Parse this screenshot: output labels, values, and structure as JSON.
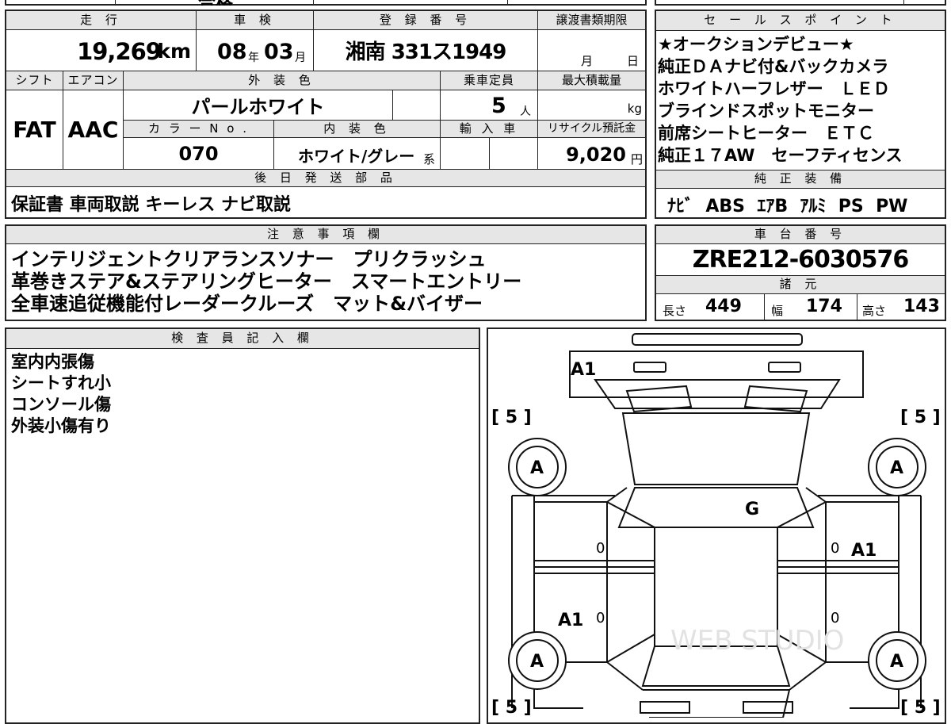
{
  "top_strip": {
    "text": "合格"
  },
  "main": {
    "labels": {
      "mileage": "走 行",
      "inspection": "車 検",
      "registration": "登 録 番 号",
      "transfer_deadline": "譲渡書類期限",
      "shift": "シフト",
      "ac": "エアコン",
      "exterior_color": "外 装 色",
      "capacity": "乗車定員",
      "max_load": "最大積載量",
      "color_no": "カ ラ ー N o .",
      "interior_color": "内 装 色",
      "import": "輸 入 車",
      "recycle_fee": "リサイクル預託金",
      "later_parts": "後 日 発 送 部 品"
    },
    "mileage": "19,269",
    "mileage_unit": "km",
    "inspection_year": "08",
    "year_suffix": "年",
    "inspection_month": "03",
    "month_suffix": "月",
    "plate": "湘南 331ス1949",
    "deadline_month_suffix": "月",
    "deadline_day_suffix": "日",
    "shift": "FAT",
    "ac": "AAC",
    "exterior_color": "パールホワイト",
    "capacity": "5",
    "capacity_unit": "人",
    "max_load_unit": "kg",
    "color_no": "070",
    "interior_color": "ホワイト/グレー",
    "interior_suffix": "系",
    "recycle_fee": "9,020",
    "recycle_unit": "円",
    "later_parts": "保証書 車両取説 キーレス ナビ取説"
  },
  "sales_points": {
    "label": "セ ー ル ス ポ イ ン ト",
    "lines": [
      "★オークションデビュー★",
      "純正ＤＡナビ付&バックカメラ",
      "ホワイトハーフレザー　ＬＥＤ",
      "ブラインドスポットモニター",
      "前席シートヒーター　ＥＴＣ",
      "純正１７AW　セーフティセンス"
    ]
  },
  "standard_equipment": {
    "label": "純 正 装 備",
    "items": [
      "ﾅﾋﾞ",
      "ABS",
      "ｴｱB",
      "ｱﾙﾐ",
      "PS",
      "PW"
    ]
  },
  "notes": {
    "label": "注 意 事 項 欄",
    "lines": [
      "インテリジェントクリアランスソナー　プリクラッシュ",
      "革巻きステア&ステアリングヒーター　スマートエントリー",
      "全車速追従機能付レーダークルーズ　マット&バイザー"
    ]
  },
  "chassis": {
    "label": "車 台 番 号",
    "number": "ZRE212-6030576",
    "spec_label": "諸 元",
    "length_label": "長さ",
    "length": "449",
    "width_label": "幅",
    "width": "174",
    "height_label": "高さ",
    "height": "143"
  },
  "inspector": {
    "label": "検 査 員 記 入 欄",
    "lines": [
      "室内内張傷",
      "シートすれ小",
      "コンソール傷",
      "外装小傷有り"
    ]
  },
  "diagram": {
    "tire_tl": "[ 5 ]",
    "tire_tr": "[ 5 ]",
    "tire_bl": "[ 5 ]",
    "tire_br": "[ 5 ]",
    "mark_front_bumper": "A1",
    "mark_wheel_fl": "A",
    "mark_wheel_fr": "A",
    "mark_wheel_rl": "A",
    "mark_wheel_rr": "A",
    "mark_windshield": "G",
    "mark_right_front_door": "A1",
    "mark_left_rear_door": "A1",
    "zero_1": "0",
    "zero_2": "0",
    "zero_3": "0",
    "zero_4": "0",
    "watermark": "WEB STUDIO"
  }
}
